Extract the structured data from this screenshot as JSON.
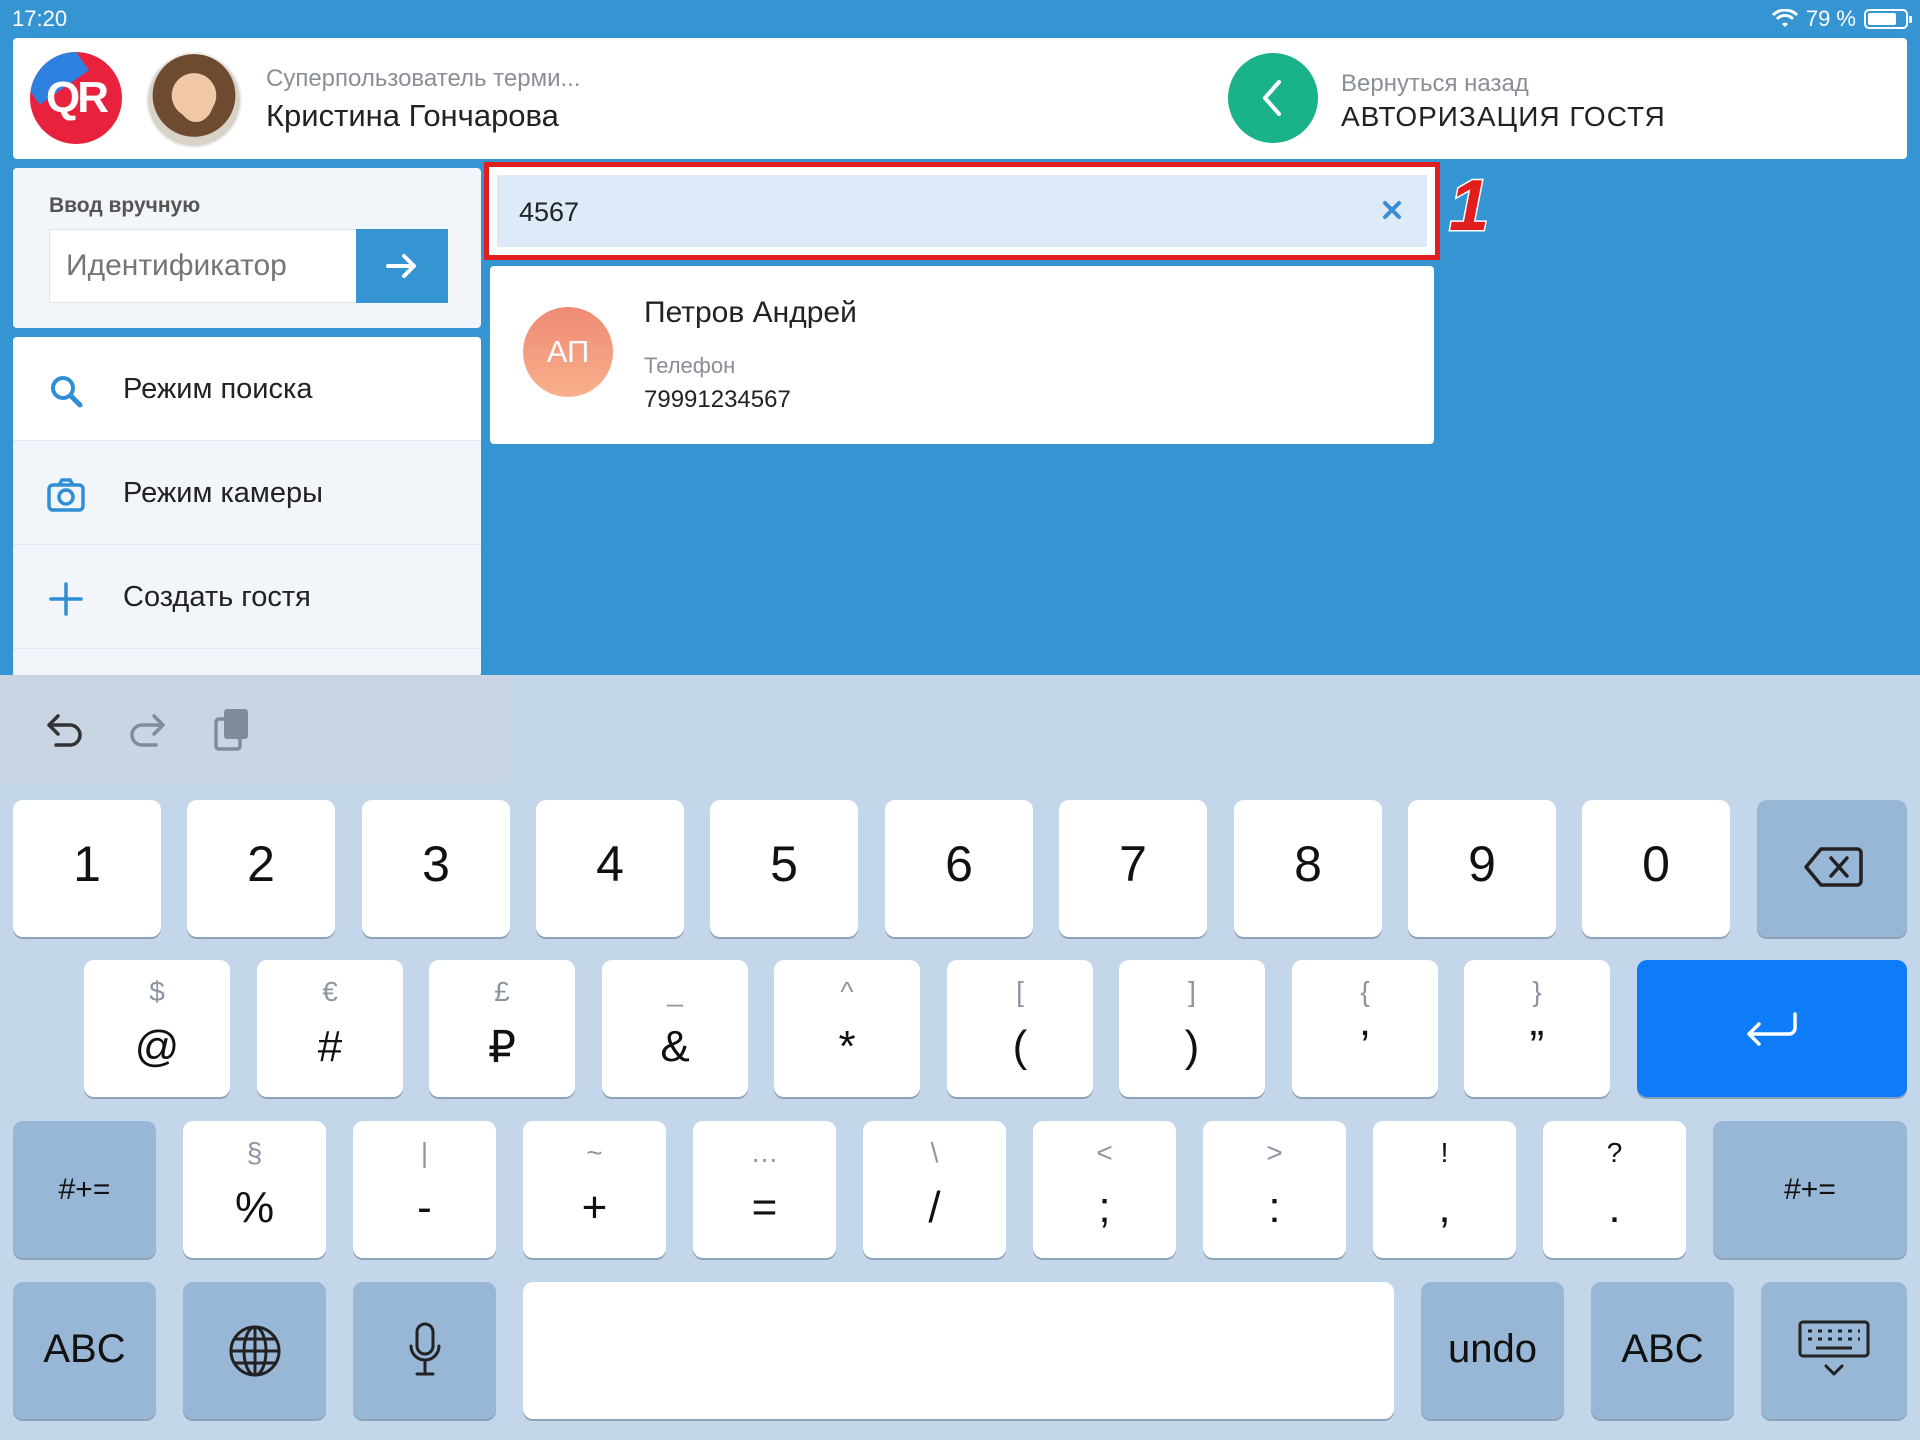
{
  "status_bar": {
    "time": "17:20",
    "battery": "79 %",
    "battery_level": 0.79
  },
  "header": {
    "logo": "QR",
    "user_role": "Суперпользователь терми...",
    "user_name": "Кристина Гончарова",
    "back_subtitle": "Вернуться назад",
    "back_title": "АВТОРИЗАЦИЯ ГОСТЯ"
  },
  "manual_entry": {
    "label": "Ввод вручную",
    "placeholder": "Идентификатор"
  },
  "menu": {
    "items": [
      {
        "label": "Режим поиска",
        "icon": "search-icon"
      },
      {
        "label": "Режим камеры",
        "icon": "camera-icon"
      },
      {
        "label": "Создать гостя",
        "icon": "plus-icon"
      }
    ]
  },
  "search": {
    "value": "4567",
    "callout": "1"
  },
  "result": {
    "initials": "АП",
    "name": "Петров Андрей",
    "phone_label": "Телефон",
    "phone": "79991234567"
  },
  "keyboard": {
    "row1": [
      "1",
      "2",
      "3",
      "4",
      "5",
      "6",
      "7",
      "8",
      "9",
      "0"
    ],
    "row2": [
      {
        "alt": "$",
        "main": "@"
      },
      {
        "alt": "€",
        "main": "#"
      },
      {
        "alt": "£",
        "main": "₽"
      },
      {
        "alt": "_",
        "main": "&"
      },
      {
        "alt": "^",
        "main": "*"
      },
      {
        "alt": "[",
        "main": "("
      },
      {
        "alt": "]",
        "main": ")"
      },
      {
        "alt": "{",
        "main": "’"
      },
      {
        "alt": "}",
        "main": "”"
      }
    ],
    "row3": [
      {
        "alt": "§",
        "main": "%"
      },
      {
        "alt": "|",
        "main": "-"
      },
      {
        "alt": "~",
        "main": "+"
      },
      {
        "alt": "…",
        "main": "="
      },
      {
        "alt": "\\",
        "main": "/"
      },
      {
        "alt": "<",
        "main": ";"
      },
      {
        "alt": ">",
        "main": ":"
      },
      {
        "alt": "!",
        "main": ","
      },
      {
        "alt": "?",
        "main": "."
      }
    ],
    "symbols_label": "#+=",
    "abc_label": "ABC",
    "undo_label": "undo"
  }
}
